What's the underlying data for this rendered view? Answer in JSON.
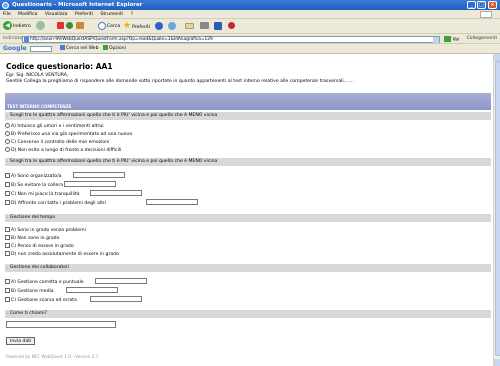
{
  "window": {
    "title": "Questionario - Microsoft Internet Explorer"
  },
  "menu": [
    "File",
    "Modifica",
    "Visualizza",
    "Preferiti",
    "Strumenti",
    "?"
  ],
  "toolbar": {
    "back": "Indietro",
    "search": "Cerca",
    "favorites": "Preferiti"
  },
  "address": {
    "label": "Indirizzo",
    "url": "http://anon-99/WebQuestASP/QuestForm.asp?Op=read&Quale=1&IdAnagrafica=129",
    "go": "Vai",
    "links": "Collegamenti"
  },
  "google": {
    "logo": "Google",
    "search_web": "Cerca nel Web",
    "options": "Opzioni"
  },
  "page": {
    "title": "Codice questionario: AA1",
    "salutation": "Egr. Sig. NICOLA VENTURA,",
    "intro": "Gentile Collega la preghiamo di rispondere alle domande sotto riportate in quanto appartenenti al test interno relative alle competenze trasversali.......",
    "section": "TEST INTERNO COMPETENZE"
  },
  "questions": [
    {
      "heading": ". Scegli tra le quattro affermazioni quella che ti è PIU' vicina e poi quella che è MENO vicina",
      "options": [
        "A) Intuisco gli umori e i sentimenti altrui",
        "B) Preferisco una via già sperimentata ad una nuova",
        "C) Conservo il controllo delle mie emozioni",
        "D) Non esito a lungo di fronte a decisioni difficili"
      ]
    },
    {
      "heading": ". Scegli tra le quattro affermazioni quella che ti è PIU' vicina e poi quella che è MENO vicina",
      "options": [
        "A) Sono organizzato/a",
        "B) So evitare la collera",
        "C) Non mi piace la tranquillità",
        "D) Affronto con tatto i problemi degli altri"
      ]
    },
    {
      "heading": ". Gestione del tempo",
      "options": [
        "A) Sono in grado senza problemi",
        "B) Non sono in grado",
        "C) Penso di essere in grado",
        "D) non credo assolutamente di essere in grado"
      ]
    },
    {
      "heading": ". Gestione dei collaboratori",
      "options": [
        "A) Gestione corretta e puntuale",
        "B) Gestione media",
        "C) Gestione scarsa ed errata"
      ]
    },
    {
      "heading": ". Come ti chiami?",
      "options": []
    }
  ],
  "form": {
    "submit": "Invia dati"
  },
  "footer": "Powered by NFC WebQuest 1.0 - Version 2.7"
}
